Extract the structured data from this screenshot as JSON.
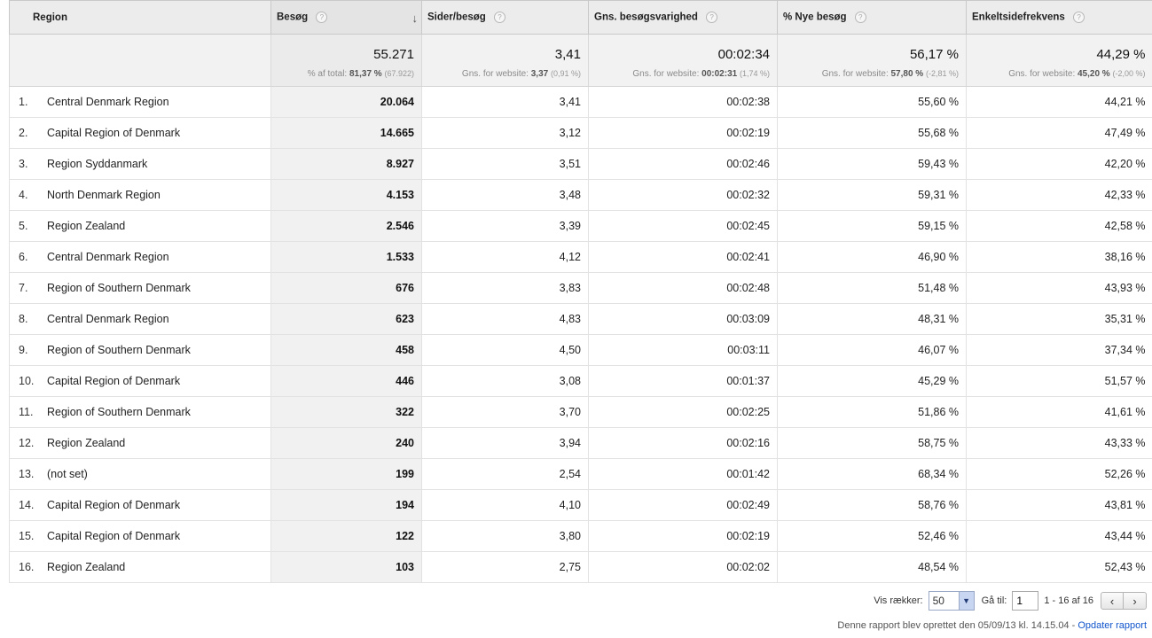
{
  "table": {
    "columns": [
      {
        "label": "Region",
        "help": false
      },
      {
        "label": "Besøg",
        "help": true,
        "sorted": true
      },
      {
        "label": "Sider/besøg",
        "help": true
      },
      {
        "label": "Gns. besøgsvarighed",
        "help": true
      },
      {
        "label": "% Nye besøg",
        "help": true
      },
      {
        "label": "Enkeltsidefrekvens",
        "help": true
      }
    ],
    "help_glyph": "?",
    "sort_glyph": "↓",
    "totals": [
      {
        "main": "55.271",
        "prefix": "% af total:",
        "bold": "81,37 %",
        "paren": "(67.922)"
      },
      {
        "main": "3,41",
        "prefix": "Gns. for website:",
        "bold": "3,37",
        "paren": "(0,91 %)"
      },
      {
        "main": "00:02:34",
        "prefix": "Gns. for website:",
        "bold": "00:02:31",
        "paren": "(1,74 %)"
      },
      {
        "main": "56,17 %",
        "prefix": "Gns. for website:",
        "bold": "57,80 %",
        "paren": "(-2,81 %)"
      },
      {
        "main": "44,29 %",
        "prefix": "Gns. for website:",
        "bold": "45,20 %",
        "paren": "(-2,00 %)"
      }
    ],
    "rows": [
      {
        "num": "1.",
        "region": "Central Denmark Region",
        "visits": "20.064",
        "pages": "3,41",
        "duration": "00:02:38",
        "new": "55,60 %",
        "bounce": "44,21 %"
      },
      {
        "num": "2.",
        "region": "Capital Region of Denmark",
        "visits": "14.665",
        "pages": "3,12",
        "duration": "00:02:19",
        "new": "55,68 %",
        "bounce": "47,49 %"
      },
      {
        "num": "3.",
        "region": "Region Syddanmark",
        "visits": "8.927",
        "pages": "3,51",
        "duration": "00:02:46",
        "new": "59,43 %",
        "bounce": "42,20 %"
      },
      {
        "num": "4.",
        "region": "North Denmark Region",
        "visits": "4.153",
        "pages": "3,48",
        "duration": "00:02:32",
        "new": "59,31 %",
        "bounce": "42,33 %"
      },
      {
        "num": "5.",
        "region": "Region Zealand",
        "visits": "2.546",
        "pages": "3,39",
        "duration": "00:02:45",
        "new": "59,15 %",
        "bounce": "42,58 %"
      },
      {
        "num": "6.",
        "region": "Central Denmark Region",
        "visits": "1.533",
        "pages": "4,12",
        "duration": "00:02:41",
        "new": "46,90 %",
        "bounce": "38,16 %"
      },
      {
        "num": "7.",
        "region": "Region of Southern Denmark",
        "visits": "676",
        "pages": "3,83",
        "duration": "00:02:48",
        "new": "51,48 %",
        "bounce": "43,93 %"
      },
      {
        "num": "8.",
        "region": "Central Denmark Region",
        "visits": "623",
        "pages": "4,83",
        "duration": "00:03:09",
        "new": "48,31 %",
        "bounce": "35,31 %"
      },
      {
        "num": "9.",
        "region": "Region of Southern Denmark",
        "visits": "458",
        "pages": "4,50",
        "duration": "00:03:11",
        "new": "46,07 %",
        "bounce": "37,34 %"
      },
      {
        "num": "10.",
        "region": "Capital Region of Denmark",
        "visits": "446",
        "pages": "3,08",
        "duration": "00:01:37",
        "new": "45,29 %",
        "bounce": "51,57 %"
      },
      {
        "num": "11.",
        "region": "Region of Southern Denmark",
        "visits": "322",
        "pages": "3,70",
        "duration": "00:02:25",
        "new": "51,86 %",
        "bounce": "41,61 %"
      },
      {
        "num": "12.",
        "region": "Region Zealand",
        "visits": "240",
        "pages": "3,94",
        "duration": "00:02:16",
        "new": "58,75 %",
        "bounce": "43,33 %"
      },
      {
        "num": "13.",
        "region": "(not set)",
        "visits": "199",
        "pages": "2,54",
        "duration": "00:01:42",
        "new": "68,34 %",
        "bounce": "52,26 %"
      },
      {
        "num": "14.",
        "region": "Capital Region of Denmark",
        "visits": "194",
        "pages": "4,10",
        "duration": "00:02:49",
        "new": "58,76 %",
        "bounce": "43,81 %"
      },
      {
        "num": "15.",
        "region": "Capital Region of Denmark",
        "visits": "122",
        "pages": "3,80",
        "duration": "00:02:19",
        "new": "52,46 %",
        "bounce": "43,44 %"
      },
      {
        "num": "16.",
        "region": "Region Zealand",
        "visits": "103",
        "pages": "2,75",
        "duration": "00:02:02",
        "new": "48,54 %",
        "bounce": "52,43 %"
      }
    ]
  },
  "pager": {
    "show_rows_label": "Vis rækker:",
    "rows_value": "50",
    "goto_label": "Gå til:",
    "goto_value": "1",
    "range": "1 - 16 af 16",
    "prev_glyph": "‹",
    "next_glyph": "›",
    "dropdown_glyph": "▼"
  },
  "footer": {
    "created_text": "Denne rapport blev oprettet den 05/09/13 kl. 14.15.04 - ",
    "update_link": "Opdater rapport"
  },
  "colors": {
    "header_bg": "#ececec",
    "sorted_bg": "#f1f1f1",
    "link": "#1155cc"
  }
}
